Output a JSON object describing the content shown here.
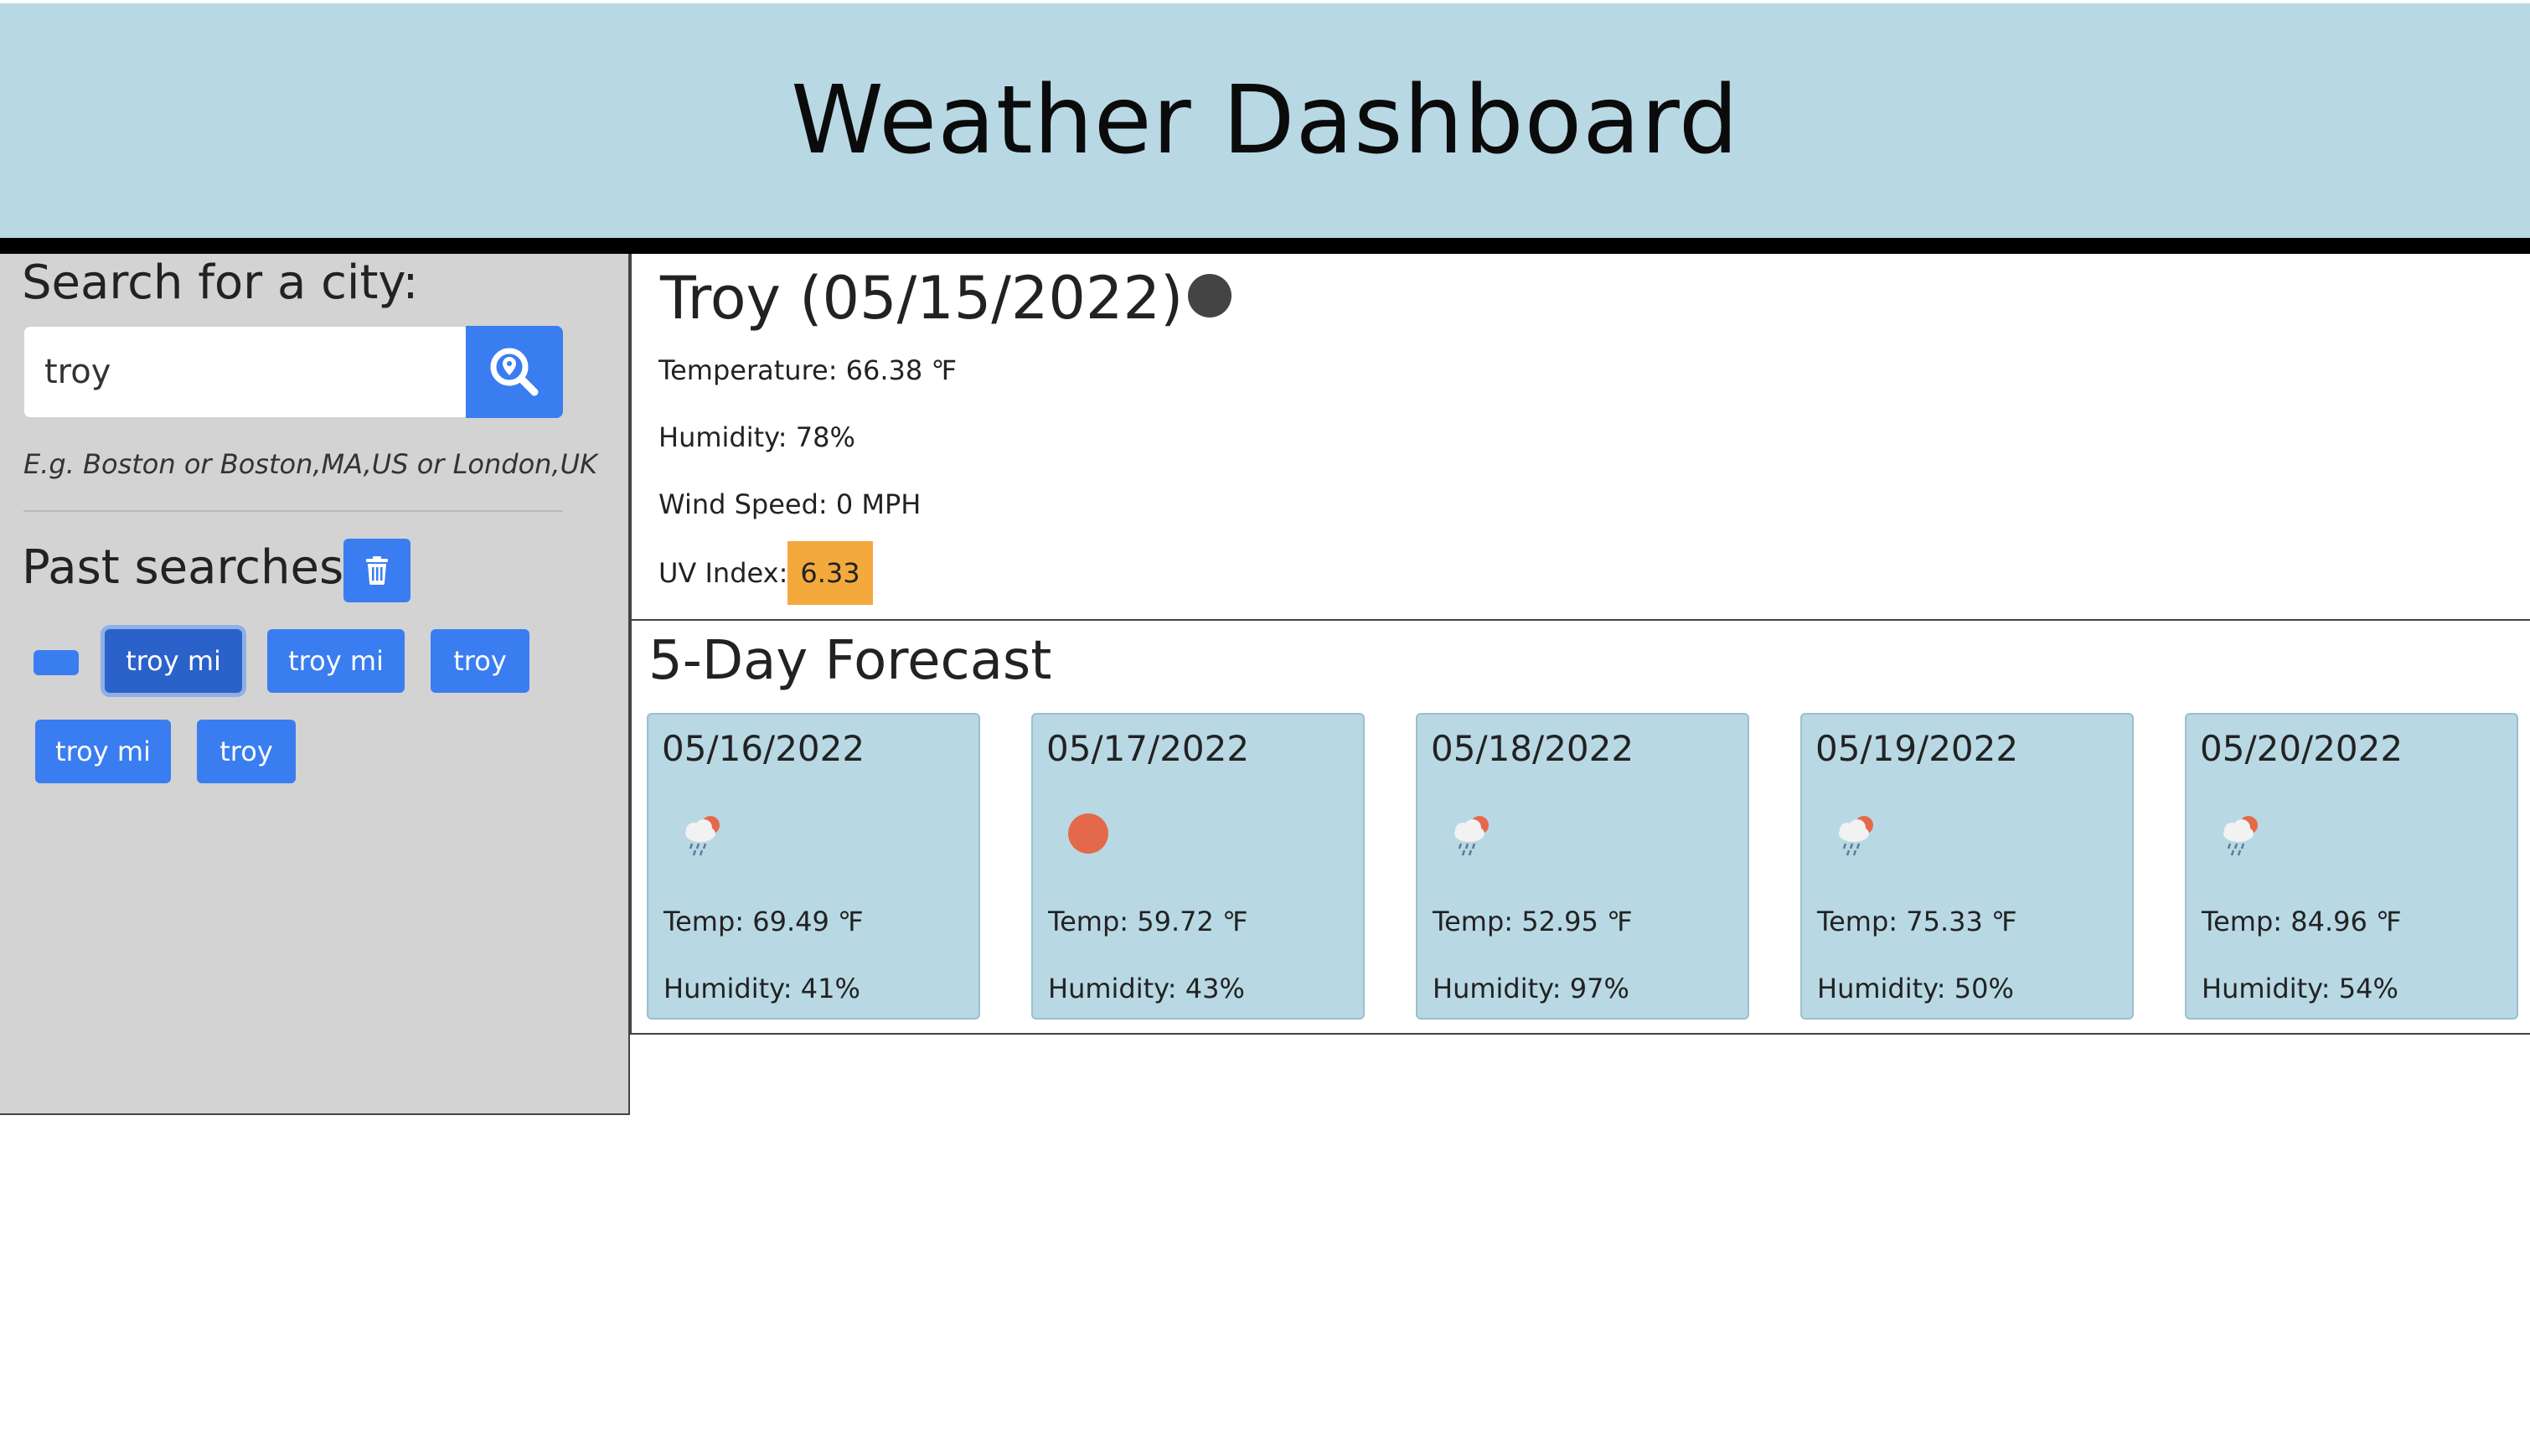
{
  "header": {
    "title": "Weather Dashboard"
  },
  "search": {
    "label": "Search for a city:",
    "value": "troy",
    "placeholder": "",
    "button_icon": "search-location-icon",
    "hint": "E.g. Boston or Boston,MA,US or London,UK"
  },
  "past": {
    "label": "Past searches",
    "clear_icon": "trash-icon",
    "items": [
      {
        "label": ""
      },
      {
        "label": "troy mi",
        "active": true
      },
      {
        "label": "troy mi"
      },
      {
        "label": "troy"
      },
      {
        "label": "troy mi"
      },
      {
        "label": "troy"
      }
    ]
  },
  "current": {
    "title": "Troy (05/15/2022)",
    "icon": "weather-icon-dark",
    "temperature": "Temperature: 66.38 ℉",
    "humidity": "Humidity: 78%",
    "wind": "Wind Speed: 0 MPH",
    "uv_label": "UV Index:",
    "uv_value": "6.33",
    "uv_color": "#f4a93c"
  },
  "forecast": {
    "title": "5-Day Forecast",
    "days": [
      {
        "date": "05/16/2022",
        "icon": "rain-sun-icon",
        "temp": "Temp: 69.49 ℉",
        "humidity": "Humidity: 41%"
      },
      {
        "date": "05/17/2022",
        "icon": "sun-icon",
        "temp": "Temp: 59.72 ℉",
        "humidity": "Humidity: 43%"
      },
      {
        "date": "05/18/2022",
        "icon": "rain-sun-icon",
        "temp": "Temp: 52.95 ℉",
        "humidity": "Humidity: 97%"
      },
      {
        "date": "05/19/2022",
        "icon": "rain-sun-icon",
        "temp": "Temp: 75.33 ℉",
        "humidity": "Humidity: 50%"
      },
      {
        "date": "05/20/2022",
        "icon": "rain-sun-icon",
        "temp": "Temp: 84.96 ℉",
        "humidity": "Humidity: 54%"
      }
    ]
  },
  "colors": {
    "header_bg": "#b8d8e4",
    "sidebar_bg": "#d3d3d3",
    "button_blue": "#3a7df0",
    "card_bg": "#b8d8e4"
  }
}
